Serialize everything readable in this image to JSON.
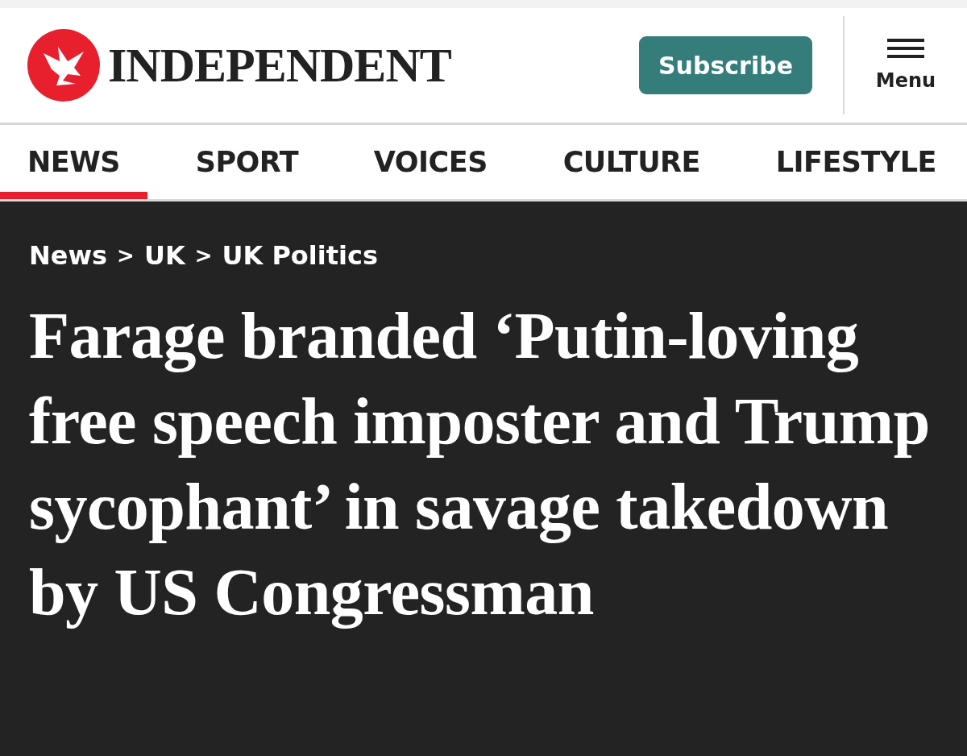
{
  "header": {
    "logo_text": "INDEPENDENT",
    "subscribe": "Subscribe",
    "menu": "Menu"
  },
  "nav": [
    {
      "label": "NEWS",
      "selected": true
    },
    {
      "label": "SPORT",
      "selected": false
    },
    {
      "label": "VOICES",
      "selected": false
    },
    {
      "label": "CULTURE",
      "selected": false
    },
    {
      "label": "LIFESTYLE",
      "selected": false
    }
  ],
  "breadcrumb": [
    {
      "label": "News"
    },
    {
      "label": "UK"
    },
    {
      "label": "UK Politics"
    }
  ],
  "breadcrumb_separator": ">",
  "headline": "Farage branded ‘Putin-loving free speech imposter and Trump sycophant’ in savage takedown by US Congressman"
}
